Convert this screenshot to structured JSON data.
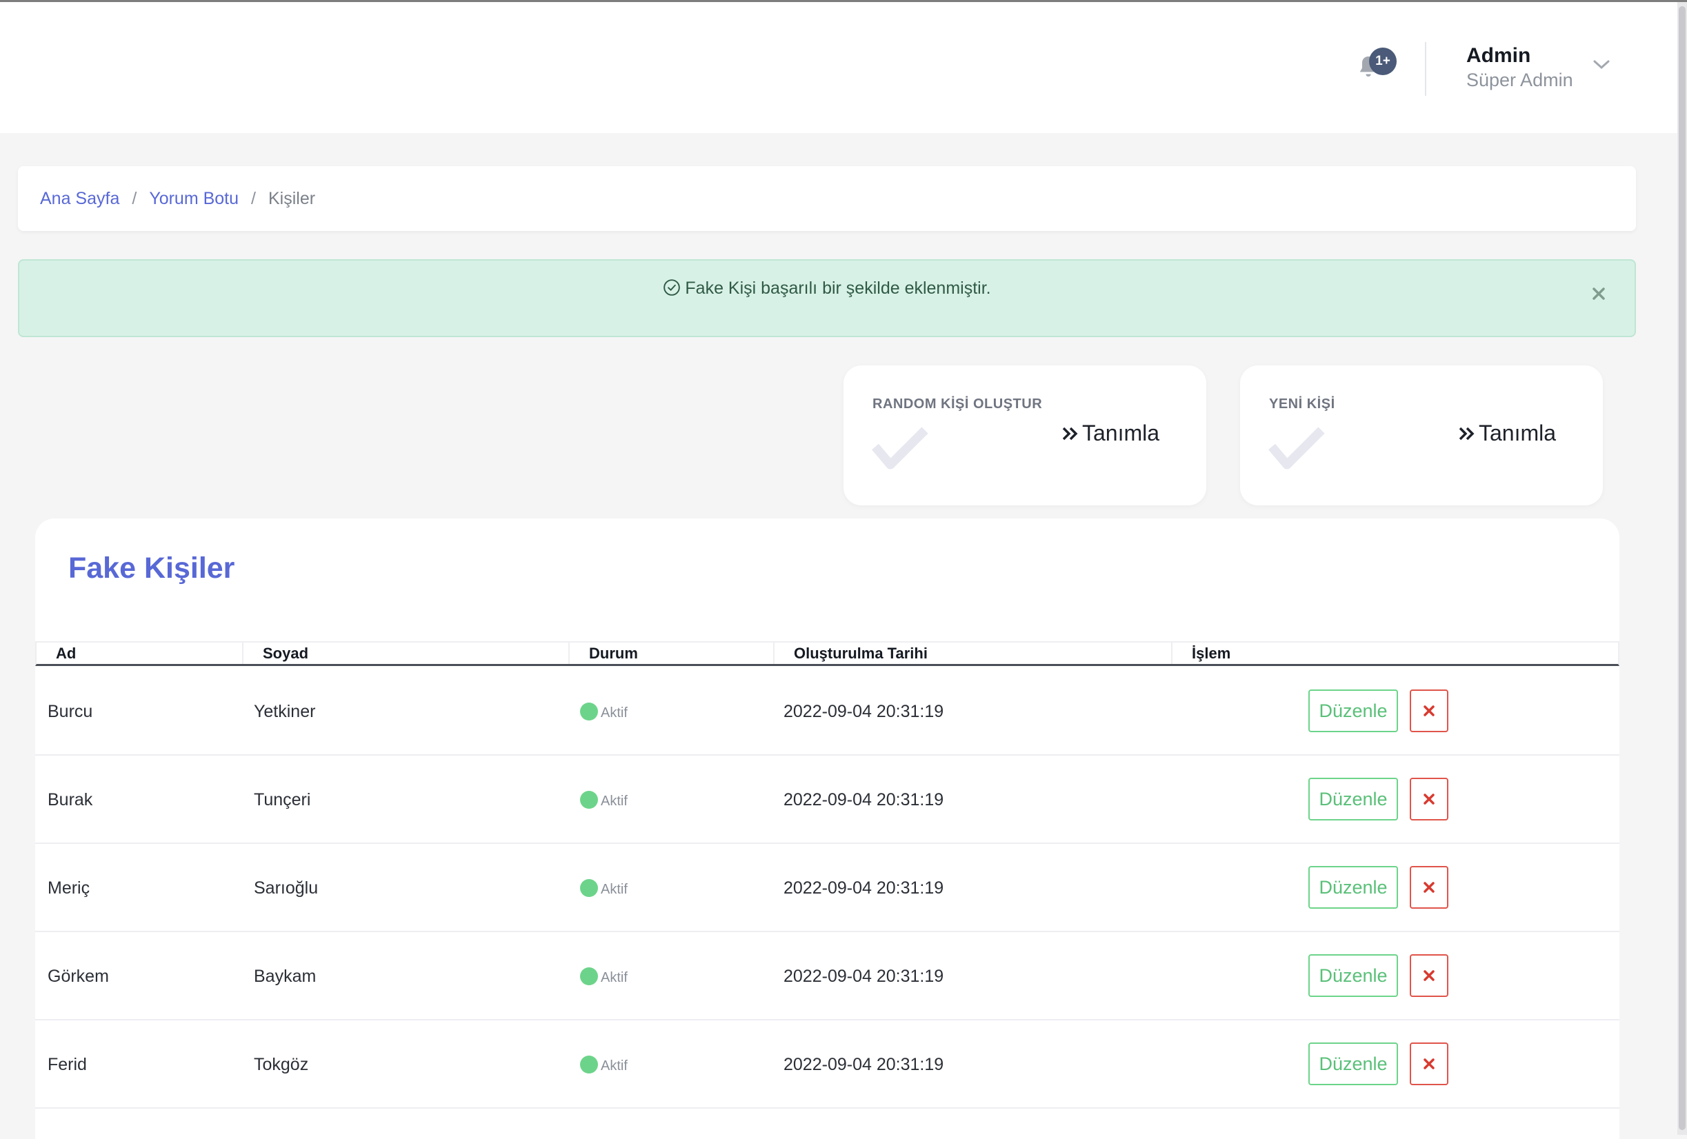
{
  "header": {
    "notification_count": "1+",
    "user_name": "Admin",
    "user_role": "Süper Admin"
  },
  "breadcrumb": {
    "items": [
      "Ana Sayfa",
      "Yorum Botu"
    ],
    "current": "Kişiler"
  },
  "alert": {
    "message": "Fake Kişi başarılı bir şekilde eklenmiştir."
  },
  "cards": [
    {
      "title": "RANDOM KİŞİ OLUŞTUR",
      "action": "Tanımla"
    },
    {
      "title": "YENİ KİŞİ",
      "action": "Tanımla"
    }
  ],
  "table": {
    "title": "Fake Kişiler",
    "columns": [
      "Ad",
      "Soyad",
      "Durum",
      "Oluşturulma Tarihi",
      "İşlem"
    ],
    "edit_label": "Düzenle",
    "rows": [
      {
        "ad": "Burcu",
        "soyad": "Yetkiner",
        "durum": "Aktif",
        "tarih": "2022-09-04 20:31:19"
      },
      {
        "ad": "Burak",
        "soyad": "Tunçeri",
        "durum": "Aktif",
        "tarih": "2022-09-04 20:31:19"
      },
      {
        "ad": "Meriç",
        "soyad": "Sarıoğlu",
        "durum": "Aktif",
        "tarih": "2022-09-04 20:31:19"
      },
      {
        "ad": "Görkem",
        "soyad": "Baykam",
        "durum": "Aktif",
        "tarih": "2022-09-04 20:31:19"
      },
      {
        "ad": "Ferid",
        "soyad": "Tokgöz",
        "durum": "Aktif",
        "tarih": "2022-09-04 20:31:19"
      }
    ]
  },
  "colors": {
    "accent": "#5868d6",
    "success": "#6cd48a",
    "danger": "#e0544a",
    "alert_bg": "#d8f1e6"
  }
}
